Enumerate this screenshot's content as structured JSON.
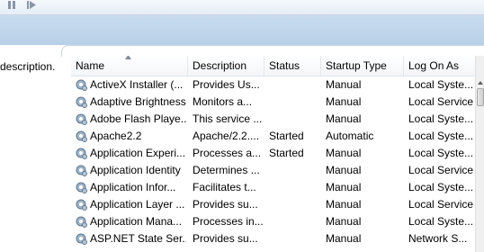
{
  "description_pane": {
    "text": "description."
  },
  "columns": {
    "name": "Name",
    "description": "Description",
    "status": "Status",
    "startup_type": "Startup Type",
    "log_on_as": "Log On As"
  },
  "services": [
    {
      "name": "ActiveX Installer (...",
      "description": "Provides Us...",
      "status": "",
      "startup_type": "Manual",
      "log_on_as": "Local Syste..."
    },
    {
      "name": "Adaptive Brightness",
      "description": "Monitors a...",
      "status": "",
      "startup_type": "Manual",
      "log_on_as": "Local Service"
    },
    {
      "name": "Adobe Flash Playe...",
      "description": "This service ...",
      "status": "",
      "startup_type": "Manual",
      "log_on_as": "Local Syste..."
    },
    {
      "name": "Apache2.2",
      "description": "Apache/2.2....",
      "status": "Started",
      "startup_type": "Automatic",
      "log_on_as": "Local Syste..."
    },
    {
      "name": "Application Experi...",
      "description": "Processes a...",
      "status": "Started",
      "startup_type": "Manual",
      "log_on_as": "Local Syste..."
    },
    {
      "name": "Application Identity",
      "description": "Determines ...",
      "status": "",
      "startup_type": "Manual",
      "log_on_as": "Local Service"
    },
    {
      "name": "Application Infor...",
      "description": "Facilitates t...",
      "status": "",
      "startup_type": "Manual",
      "log_on_as": "Local Syste..."
    },
    {
      "name": "Application Layer ...",
      "description": "Provides su...",
      "status": "",
      "startup_type": "Manual",
      "log_on_as": "Local Service"
    },
    {
      "name": "Application Mana...",
      "description": "Processes in...",
      "status": "",
      "startup_type": "Manual",
      "log_on_as": "Local Syste..."
    },
    {
      "name": "ASP.NET State Ser...",
      "description": "Provides su...",
      "status": "",
      "startup_type": "Manual",
      "log_on_as": "Network S..."
    }
  ],
  "icons": {
    "service": "gear-service-icon",
    "sort": "sort-ascending-icon"
  }
}
